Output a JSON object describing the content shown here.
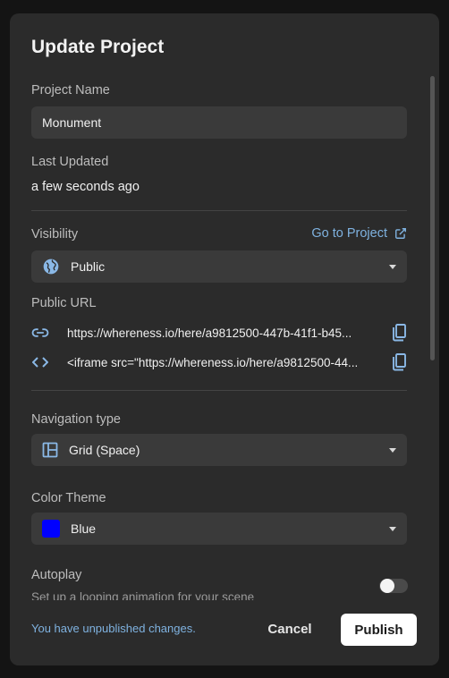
{
  "dialog": {
    "title": "Update Project",
    "project_name": {
      "label": "Project Name",
      "value": "Monument"
    },
    "last_updated": {
      "label": "Last Updated",
      "value": "a few seconds ago"
    },
    "visibility": {
      "label": "Visibility",
      "go_to_project": "Go to Project",
      "selected": "Public",
      "icon": "globe-icon"
    },
    "public_url": {
      "label": "Public URL",
      "link": "https://whereness.io/here/a9812500-447b-41f1-b45...",
      "embed": "<iframe src=\"https://whereness.io/here/a9812500-44..."
    },
    "navigation": {
      "label": "Navigation type",
      "selected": "Grid (Space)",
      "icon": "grid-layout-icon"
    },
    "color_theme": {
      "label": "Color Theme",
      "selected": "Blue",
      "swatch_color": "#0000ff"
    },
    "autoplay": {
      "label": "Autoplay",
      "description": "Set up a looping animation for your scene",
      "enabled": false
    }
  },
  "footer": {
    "status": "You have unpublished changes.",
    "cancel_label": "Cancel",
    "publish_label": "Publish"
  },
  "colors": {
    "accent": "#7fb2e0",
    "icon": "#8ab8e6",
    "background": "#2b2b2b",
    "field": "#3a3a3a"
  }
}
